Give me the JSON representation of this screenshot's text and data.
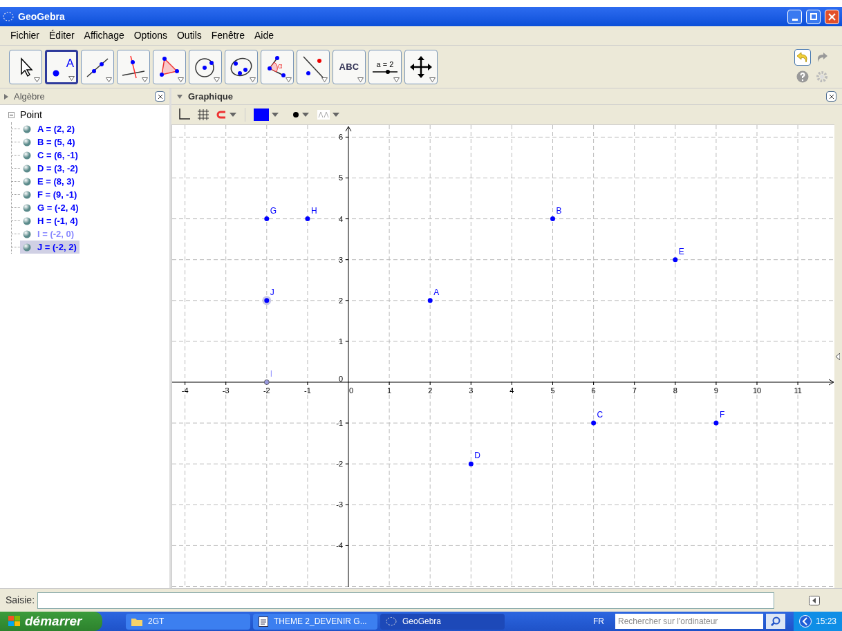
{
  "window": {
    "title": "GeoGebra"
  },
  "menu": [
    "Fichier",
    "Éditer",
    "Affichage",
    "Options",
    "Outils",
    "Fenêtre",
    "Aide"
  ],
  "tools": [
    {
      "kind": "move",
      "selected": false
    },
    {
      "kind": "point",
      "label": "A",
      "selected": true
    },
    {
      "kind": "line",
      "selected": false
    },
    {
      "kind": "perpendicular",
      "selected": false
    },
    {
      "kind": "polygon",
      "selected": false
    },
    {
      "kind": "circle",
      "selected": false
    },
    {
      "kind": "conic",
      "selected": false
    },
    {
      "kind": "angle",
      "label": "α",
      "selected": false
    },
    {
      "kind": "reflect",
      "selected": false
    },
    {
      "kind": "text",
      "label": "ABC",
      "selected": false
    },
    {
      "kind": "slider",
      "label": "a = 2",
      "selected": false
    },
    {
      "kind": "move-view",
      "selected": false
    }
  ],
  "algebra": {
    "title": "Algèbre",
    "items": [
      {
        "label": "Point",
        "expanded": true,
        "children": [
          {
            "text": "A = (2, 2)",
            "selected": false,
            "faded": false
          },
          {
            "text": "B = (5, 4)",
            "selected": false,
            "faded": false
          },
          {
            "text": "C = (6, -1)",
            "selected": false,
            "faded": false
          },
          {
            "text": "D = (3, -2)",
            "selected": false,
            "faded": false
          },
          {
            "text": "E = (8, 3)",
            "selected": false,
            "faded": false
          },
          {
            "text": "F = (9, -1)",
            "selected": false,
            "faded": false
          },
          {
            "text": "G = (-2, 4)",
            "selected": false,
            "faded": false
          },
          {
            "text": "H = (-1, 4)",
            "selected": false,
            "faded": false
          },
          {
            "text": "I = (-2, 0)",
            "selected": false,
            "faded": true
          },
          {
            "text": "J = (-2, 2)",
            "selected": true,
            "faded": false
          }
        ]
      }
    ]
  },
  "graphics": {
    "title": "Graphique",
    "chart_data": {
      "type": "scatter",
      "x": [
        2,
        5,
        6,
        3,
        8,
        9,
        -2,
        -1,
        -2,
        -2
      ],
      "series": [
        {
          "color": "#0000ff",
          "values": [
            2,
            4,
            -1,
            -2,
            3,
            -1,
            4,
            4,
            null,
            2
          ]
        },
        {
          "color": "#9999dd",
          "values": [
            null,
            null,
            null,
            null,
            null,
            null,
            null,
            null,
            0,
            null
          ]
        }
      ],
      "grid": true,
      "xlim": [
        -4.315,
        11.895
      ],
      "ylim": [
        -5.008,
        6.294
      ],
      "xticks": [
        -4,
        -3,
        -2,
        -1,
        0,
        1,
        2,
        3,
        4,
        5,
        6,
        7,
        8,
        9,
        10,
        11
      ],
      "yticks": [
        -4,
        -3,
        -2,
        -1,
        0,
        1,
        2,
        3,
        4,
        5,
        6
      ],
      "annotations": [
        {
          "text": "A",
          "x": 2,
          "y": 2
        },
        {
          "text": "B",
          "x": 5,
          "y": 4
        },
        {
          "text": "C",
          "x": 6,
          "y": -1
        },
        {
          "text": "D",
          "x": 3,
          "y": -2
        },
        {
          "text": "E",
          "x": 8,
          "y": 3
        },
        {
          "text": "F",
          "x": 9,
          "y": -1
        },
        {
          "text": "G",
          "x": -2,
          "y": 4
        },
        {
          "text": "H",
          "x": -1,
          "y": 4
        },
        {
          "text": "I",
          "x": -2,
          "y": 0
        },
        {
          "text": "J",
          "x": -2,
          "y": 2
        }
      ]
    }
  },
  "input_bar": {
    "label": "Saisie:"
  },
  "taskbar": {
    "start": "démarrer",
    "tasks": [
      {
        "kind": "folder",
        "label": "2GT",
        "selected": false
      },
      {
        "kind": "document",
        "label": "THEME 2_DEVENIR G...",
        "selected": false
      },
      {
        "kind": "geogebra",
        "label": "GeoGebra",
        "selected": true
      }
    ],
    "language": "FR",
    "search_placeholder": "Rechercher sur l'ordinateur",
    "clock": "15:23"
  }
}
